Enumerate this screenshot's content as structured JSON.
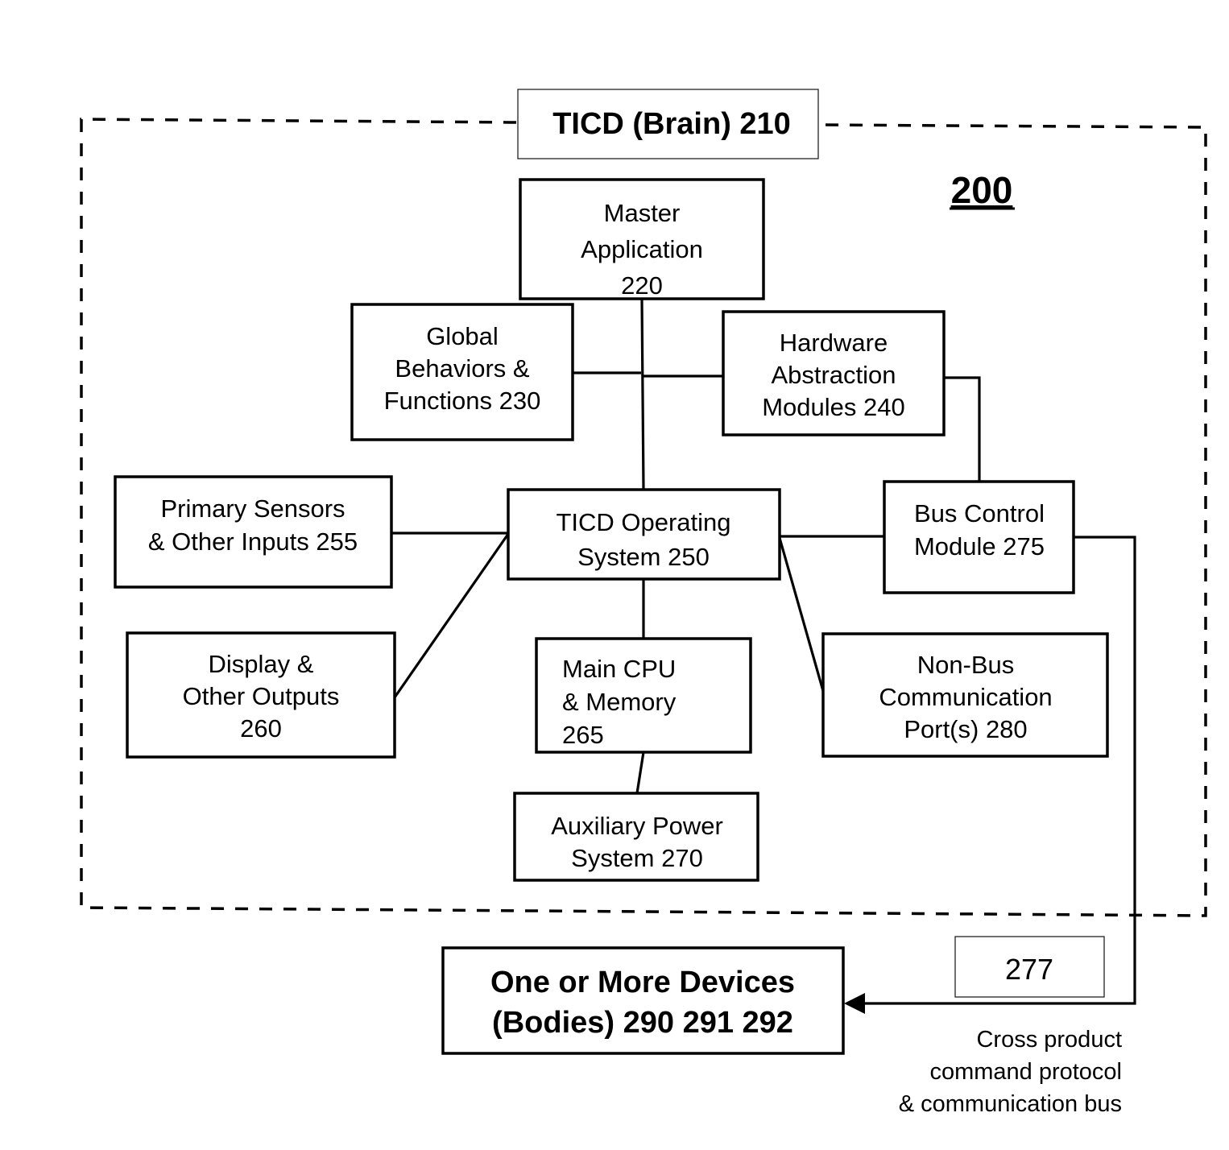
{
  "figure_label": "200",
  "container": {
    "label": "TICD (Brain) 210"
  },
  "nodes": [
    {
      "id": "master-application",
      "lines": [
        "Master",
        "Application",
        "220"
      ]
    },
    {
      "id": "global-behaviors",
      "lines": [
        "Global",
        "Behaviors &",
        "Functions 230"
      ]
    },
    {
      "id": "hardware-abstraction",
      "lines": [
        "Hardware",
        "Abstraction",
        "Modules 240"
      ]
    },
    {
      "id": "primary-sensors",
      "lines": [
        "Primary Sensors",
        "& Other Inputs 255"
      ]
    },
    {
      "id": "ticd-operating-system",
      "lines": [
        "TICD Operating",
        "System 250"
      ]
    },
    {
      "id": "bus-control-module",
      "lines": [
        "Bus Control",
        "Module 275"
      ]
    },
    {
      "id": "display-outputs",
      "lines": [
        "Display &",
        "Other Outputs",
        "260"
      ]
    },
    {
      "id": "main-cpu-memory",
      "lines": [
        "Main CPU",
        "& Memory",
        "265"
      ]
    },
    {
      "id": "non-bus-ports",
      "lines": [
        "Non-Bus",
        "Communication",
        "Port(s) 280"
      ]
    },
    {
      "id": "auxiliary-power",
      "lines": [
        "Auxiliary Power",
        "System 270"
      ]
    },
    {
      "id": "devices-bodies",
      "lines": [
        "One or More Devices",
        "(Bodies) 290 291 292"
      ]
    }
  ],
  "edges": [
    {
      "from": "master-application",
      "to": "ticd-operating-system"
    },
    {
      "from": "global-behaviors",
      "to": "hardware-abstraction"
    },
    {
      "from": "hardware-abstraction",
      "to": "bus-control-module"
    },
    {
      "from": "primary-sensors",
      "to": "ticd-operating-system"
    },
    {
      "from": "display-outputs",
      "to": "ticd-operating-system"
    },
    {
      "from": "ticd-operating-system",
      "to": "bus-control-module"
    },
    {
      "from": "ticd-operating-system",
      "to": "main-cpu-memory"
    },
    {
      "from": "ticd-operating-system",
      "to": "non-bus-ports"
    },
    {
      "from": "main-cpu-memory",
      "to": "auxiliary-power"
    },
    {
      "from": "bus-control-module",
      "to": "devices-bodies",
      "arrow": true,
      "label": "277"
    }
  ],
  "bus_tag": "277",
  "bus_note": [
    "Cross product",
    "command protocol",
    "& communication bus"
  ]
}
